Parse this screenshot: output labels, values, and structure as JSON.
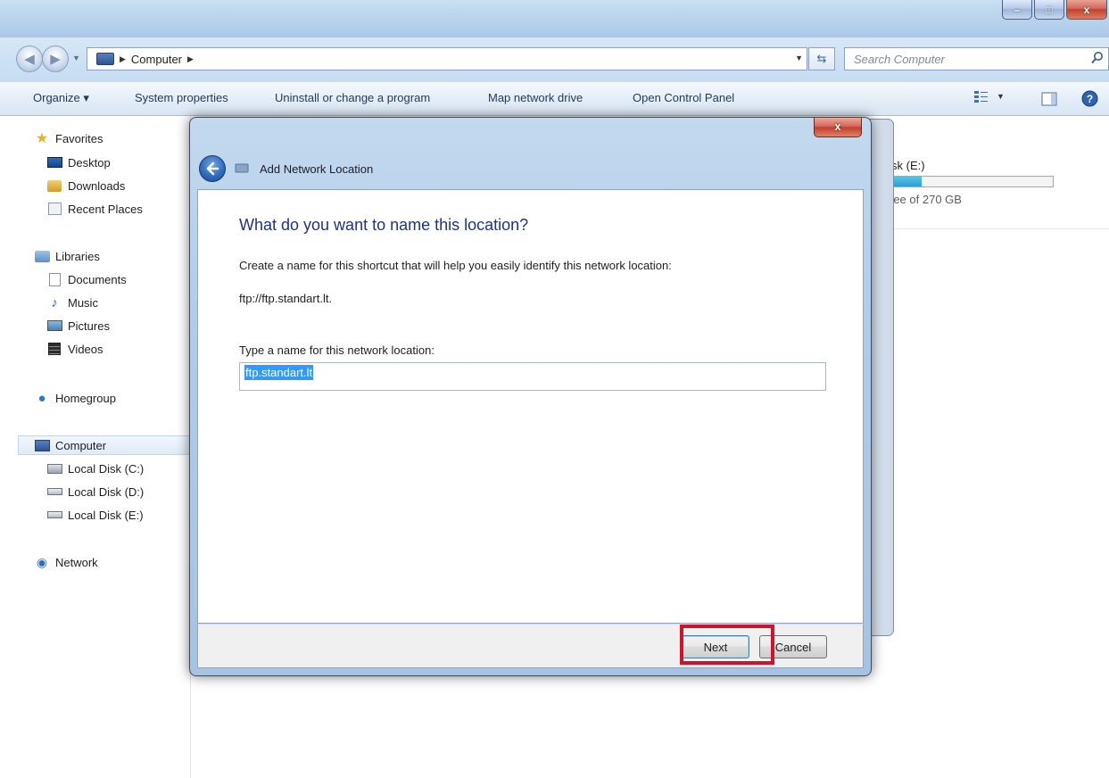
{
  "window": {
    "controls": {
      "minimize": "–",
      "maximize": "□",
      "close": "x"
    }
  },
  "address_bar": {
    "path": "Computer",
    "search_placeholder": "Search Computer"
  },
  "toolbar": {
    "organize": "Organize ▾",
    "system_properties": "System properties",
    "uninstall": "Uninstall or change a program",
    "map_drive": "Map network drive",
    "control_panel": "Open Control Panel"
  },
  "sidebar": {
    "favorites": "Favorites",
    "desktop": "Desktop",
    "downloads": "Downloads",
    "recent": "Recent Places",
    "libraries": "Libraries",
    "documents": "Documents",
    "music": "Music",
    "pictures": "Pictures",
    "videos": "Videos",
    "homegroup": "Homegroup",
    "computer": "Computer",
    "disk_c": "Local Disk (C:)",
    "disk_d": "Local Disk (D:)",
    "disk_e": "Local Disk (E:)",
    "network": "Network"
  },
  "background_content": {
    "disk_label_partial": "sk (E:)",
    "disk_free_partial": "ree of 270 GB",
    "disk_used_fraction": 0.2
  },
  "dialog": {
    "title": "Add Network Location",
    "close_label": "x",
    "heading": "What do you want to name this location?",
    "description": "Create a name for this shortcut that will help you easily identify this network location:",
    "address": "ftp://ftp.standart.lt.",
    "field_label": "Type a name for this network location:",
    "field_value": "ftp.standart.lt",
    "next_label": "Next",
    "cancel_label": "Cancel"
  },
  "colors": {
    "highlight": "#d0122b",
    "heading": "#1e3287",
    "selection": "#3399ff"
  }
}
